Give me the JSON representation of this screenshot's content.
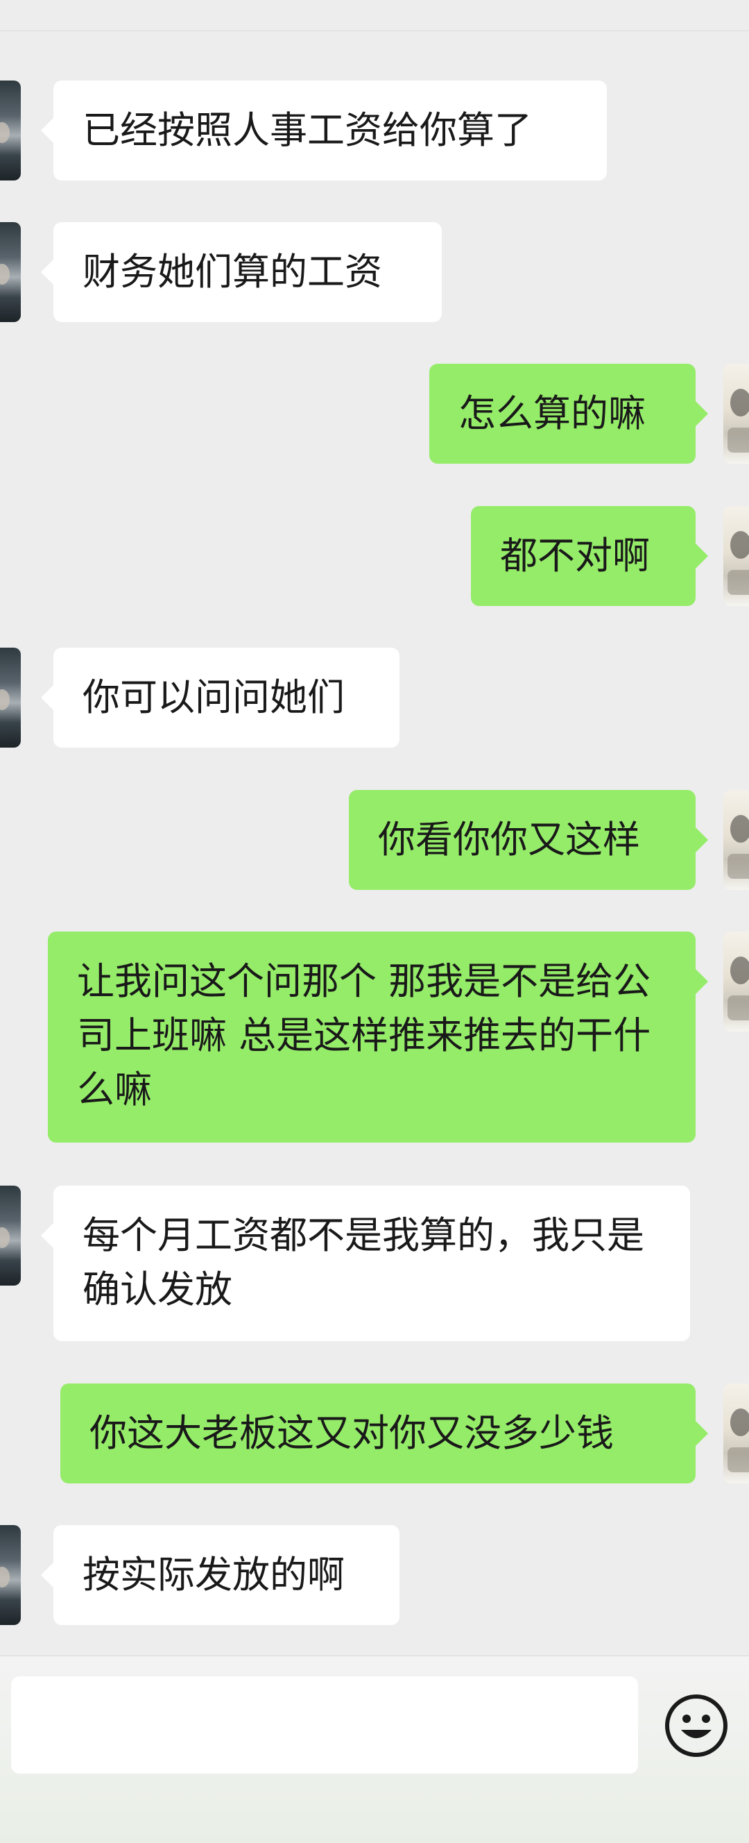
{
  "messages": [
    {
      "side": "left",
      "text": "已经按照人事工资给你算了"
    },
    {
      "side": "left",
      "text": "财务她们算的工资"
    },
    {
      "side": "right",
      "text": "怎么算的嘛"
    },
    {
      "side": "right",
      "text": "都不对啊"
    },
    {
      "side": "left",
      "text": "你可以问问她们"
    },
    {
      "side": "right",
      "text": "你看你你又这样"
    },
    {
      "side": "right",
      "text": "让我问这个问那个 那我是不是给公司上班嘛 总是这样推来推去的干什么嘛"
    },
    {
      "side": "left",
      "text": "每个月工资都不是我算的，我只是确认发放"
    },
    {
      "side": "right",
      "text": "你这大老板这又对你又没多少钱"
    },
    {
      "side": "left",
      "text": "按实际发放的啊"
    }
  ],
  "input": {
    "value": "",
    "placeholder": ""
  },
  "icons": {
    "emoji": "smiley-face-icon"
  },
  "colors": {
    "background": "#ededed",
    "incoming_bubble": "#ffffff",
    "outgoing_bubble": "#95ec69",
    "text": "#191919"
  }
}
